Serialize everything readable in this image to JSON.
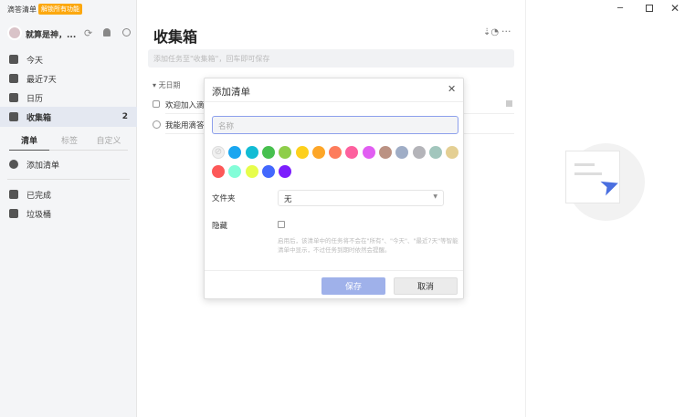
{
  "app": {
    "title": "滴答清单",
    "upgrade_badge": "解锁所有功能",
    "window_controls": [
      "minimize",
      "maximize",
      "close"
    ]
  },
  "sidebar": {
    "username": "就算是神，...",
    "items": [
      {
        "label": "今天",
        "icon": "calendar-day-icon"
      },
      {
        "label": "最近7天",
        "icon": "calendar-week-icon"
      },
      {
        "label": "日历",
        "icon": "calendar-icon"
      },
      {
        "label": "收集箱",
        "icon": "inbox-icon",
        "count": "2",
        "active": true
      }
    ],
    "tabs": [
      {
        "label": "清单",
        "active": true
      },
      {
        "label": "标签"
      },
      {
        "label": "自定义"
      }
    ],
    "add_list": "添加清单",
    "completed": "已完成",
    "trash": "垃圾桶"
  },
  "main": {
    "title": "收集箱",
    "add_task_placeholder": "添加任务至\"收集箱\"，回车即可保存",
    "section": "无日期",
    "tasks": [
      {
        "title": "欢迎加入滴"
      },
      {
        "title": "我能用滴答"
      }
    ]
  },
  "dialog": {
    "title": "添加清单",
    "name_placeholder": "名称",
    "colors": [
      "none",
      "#1aa6f0",
      "#12bcd4",
      "#47c04e",
      "#8fce4a",
      "#fdd01c",
      "#fda628",
      "#fd7c5c",
      "#fd609e",
      "#e15ef2",
      "#bb9283",
      "#9fadc6",
      "#b4b4b9",
      "#a2c6bd",
      "#e4cf93",
      "#fd5858",
      "#83fdd8",
      "#e7fd4b",
      "#4368fd",
      "#7c1efd"
    ],
    "folder_label": "文件夹",
    "folder_value": "无",
    "hidden_label": "隐藏",
    "hidden_checked": false,
    "hint": "启用后，该清单中的任务将不会在\"所有\"、\"今天\"、\"最近7天\"等智能清单中显示，不过任务到期时依然会提醒。",
    "save": "保存",
    "cancel": "取消"
  }
}
